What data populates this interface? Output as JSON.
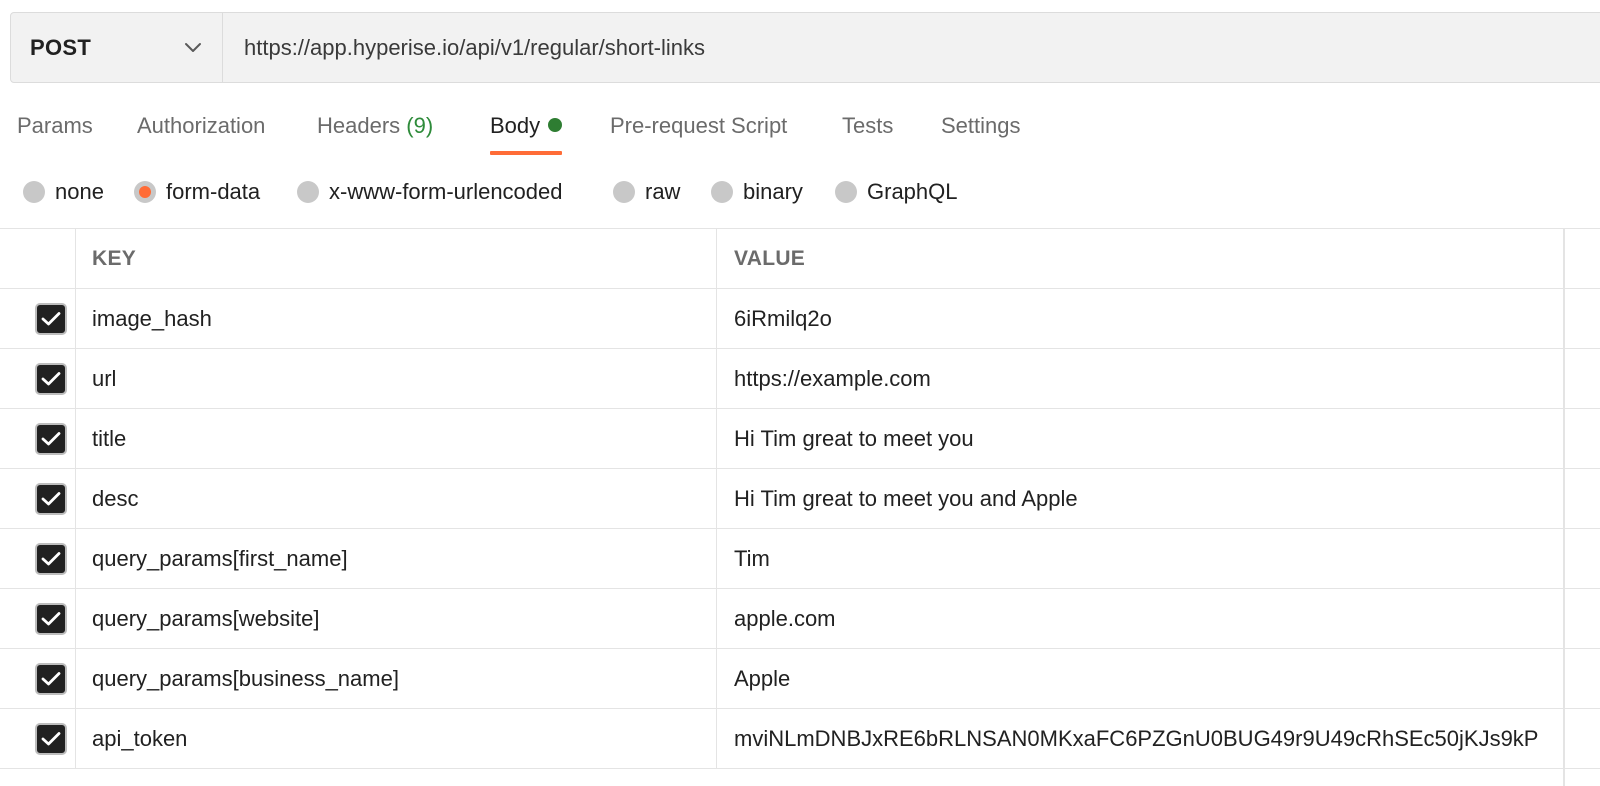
{
  "request": {
    "method": "POST",
    "url": "https://app.hyperise.io/api/v1/regular/short-links"
  },
  "tabs": [
    {
      "label": "Params"
    },
    {
      "label": "Authorization"
    },
    {
      "label": "Headers",
      "count": "(9)"
    },
    {
      "label": "Body",
      "active": true
    },
    {
      "label": "Pre-request Script"
    },
    {
      "label": "Tests"
    },
    {
      "label": "Settings"
    }
  ],
  "body_types": [
    {
      "label": "none",
      "checked": false
    },
    {
      "label": "form-data",
      "checked": true
    },
    {
      "label": "x-www-form-urlencoded",
      "checked": false
    },
    {
      "label": "raw",
      "checked": false
    },
    {
      "label": "binary",
      "checked": false
    },
    {
      "label": "GraphQL",
      "checked": false
    }
  ],
  "table": {
    "headers": {
      "key": "KEY",
      "value": "VALUE"
    },
    "rows": [
      {
        "checked": true,
        "key": "image_hash",
        "value": "6iRmilq2o"
      },
      {
        "checked": true,
        "key": "url",
        "value": "https://example.com"
      },
      {
        "checked": true,
        "key": "title",
        "value": "Hi Tim great to meet you"
      },
      {
        "checked": true,
        "key": "desc",
        "value": "Hi Tim great to meet you and Apple"
      },
      {
        "checked": true,
        "key": "query_params[first_name]",
        "value": "Tim"
      },
      {
        "checked": true,
        "key": "query_params[website]",
        "value": "apple.com"
      },
      {
        "checked": true,
        "key": "query_params[business_name]",
        "value": "Apple"
      },
      {
        "checked": true,
        "key": "api_token",
        "value": "mviNLmDNBJxRE6bRLNSAN0MKxaFC6PZGnU0BUG49r9U49cRhSEc50jKJs9kP"
      }
    ]
  },
  "colors": {
    "accent": "#ff6c37",
    "status_dot": "#2e7d32",
    "count_text": "#2e8b3a"
  }
}
